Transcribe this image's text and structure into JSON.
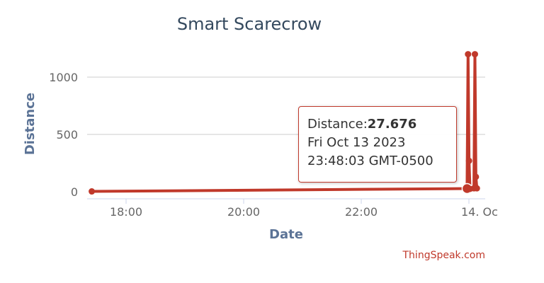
{
  "chart_data": {
    "type": "line",
    "title": "Smart Scarecrow",
    "xlabel": "Date",
    "ylabel": "Distance",
    "x_tick_labels": [
      "18:00",
      "20:00",
      "22:00",
      "14. Oc"
    ],
    "y_tick_labels": [
      "0",
      "500",
      "1000"
    ],
    "ylim": [
      0,
      1200
    ],
    "grid": true,
    "series": [
      {
        "color": "#c0392b",
        "points": [
          {
            "x": "2023-10-13 17:25",
            "y": 3
          },
          {
            "x": "2023-10-13 23:48",
            "y": 27.676
          },
          {
            "x": "2023-10-13 23:49",
            "y": 1200
          },
          {
            "x": "2023-10-13 23:50",
            "y": 270
          },
          {
            "x": "2023-10-13 23:51",
            "y": 25
          },
          {
            "x": "2023-10-13 23:55",
            "y": 30
          },
          {
            "x": "2023-10-13 23:56",
            "y": 1200
          },
          {
            "x": "2023-10-13 23:57",
            "y": 130
          },
          {
            "x": "2023-10-13 23:58",
            "y": 30
          }
        ]
      }
    ],
    "tooltip": {
      "label": "Distance:",
      "value": "27.676",
      "date_line": "Fri Oct 13 2023",
      "time_line": "23:48:03 GMT-0500"
    },
    "credit": "ThingSpeak.com"
  }
}
